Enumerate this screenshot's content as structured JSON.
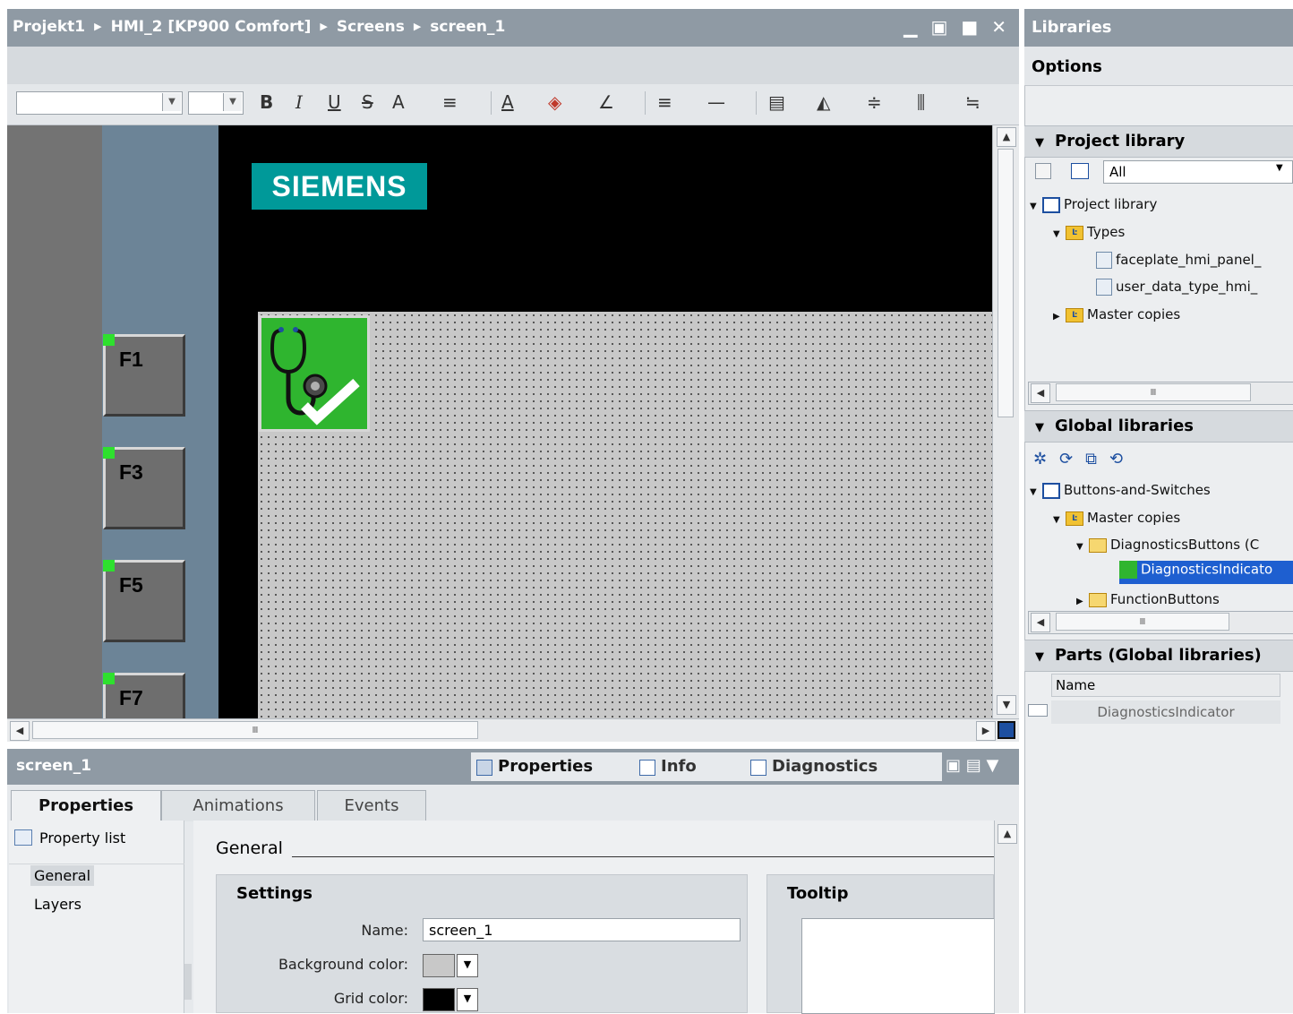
{
  "titlebar": {
    "crumbs": [
      "Projekt1",
      "HMI_2 [KP900 Comfort]",
      "Screens",
      "screen_1"
    ],
    "window_buttons": "▁ ▣ ■ ✕"
  },
  "toolbar": {
    "buttons": [
      "B",
      "I",
      "U",
      "S",
      "A",
      "≡",
      "A",
      "◈",
      "∠",
      "≡",
      "—",
      "▤",
      "◭",
      "≑",
      "⫼",
      "≒"
    ]
  },
  "screen": {
    "logo_text": "SIEMENS",
    "function_keys": [
      "F1",
      "F3",
      "F5",
      "F7"
    ],
    "scroll_thumb_glyph": "Ⅲ"
  },
  "inspector": {
    "object_name": "screen_1",
    "top_tabs": [
      "Properties",
      "Info",
      "Diagnostics"
    ],
    "sub_tabs": [
      "Properties",
      "Animations",
      "Events"
    ],
    "property_list_label": "Property list",
    "nav_items": [
      "General",
      "Layers"
    ],
    "section_title": "General",
    "settings": {
      "title": "Settings",
      "name_label": "Name:",
      "name_value": "screen_1",
      "bg_color_label": "Background color:",
      "bg_color": "#c8c8c8",
      "grid_color_label": "Grid color:",
      "grid_color": "#000000"
    },
    "tooltip_title": "Tooltip"
  },
  "libraries": {
    "title": "Libraries",
    "options_label": "Options",
    "project_library": {
      "header": "Project library",
      "filter_value": "All",
      "tree": [
        {
          "label": "Project library",
          "level": 0
        },
        {
          "label": "Types",
          "level": 1
        },
        {
          "label": "faceplate_hmi_panel_",
          "level": 3
        },
        {
          "label": "user_data_type_hmi_",
          "level": 3
        },
        {
          "label": "Master copies",
          "level": 1
        }
      ]
    },
    "global_libraries": {
      "header": "Global libraries",
      "tree": [
        {
          "label": "Buttons-and-Switches",
          "level": 0
        },
        {
          "label": "Master copies",
          "level": 1
        },
        {
          "label": "DiagnosticsButtons (C",
          "level": 2
        },
        {
          "label": "DiagnosticsIndicato",
          "level": 3,
          "selected": true
        },
        {
          "label": "FunctionButtons",
          "level": 2
        }
      ]
    },
    "parts": {
      "header": "Parts (Global libraries)",
      "column": "Name",
      "rows": [
        "DiagnosticsIndicator"
      ]
    }
  },
  "colors": {
    "siemens_teal": "#009999",
    "titlebar": "#8f9aa4",
    "selection": "#1e5fd0",
    "diag_green": "#2fb52f"
  }
}
